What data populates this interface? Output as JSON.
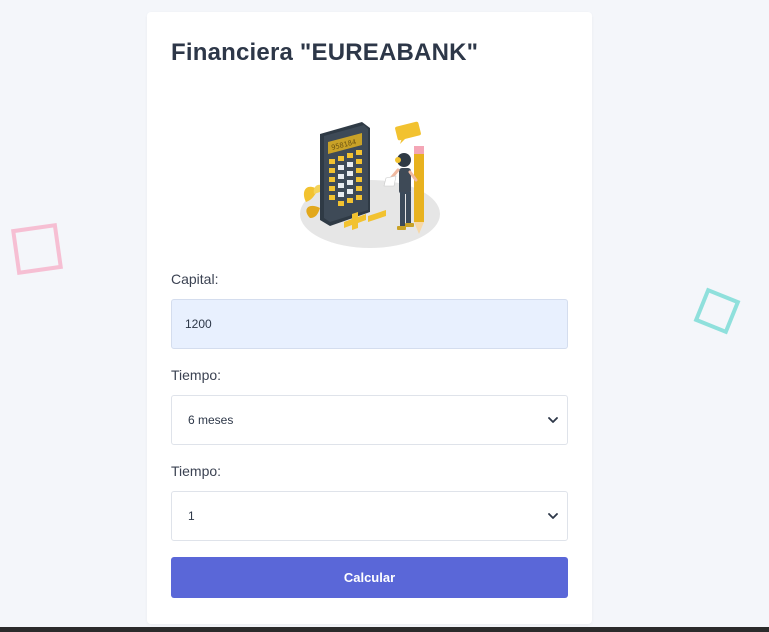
{
  "page": {
    "title": "Financiera \"EUREABANK\""
  },
  "form": {
    "capital_label": "Capital:",
    "capital_value": "1200",
    "tiempo_label_1": "Tiempo:",
    "tiempo_value_1": "6 meses",
    "tiempo_label_2": "Tiempo:",
    "tiempo_value_2": "1",
    "calcular_label": "Calcular"
  },
  "illustration": {
    "calculator_display": "958184"
  },
  "colors": {
    "accent": "#5a67d8",
    "input_bg": "#e8f0fe",
    "deco_pink": "#f6bfd3",
    "deco_teal": "#8fe0dc"
  }
}
